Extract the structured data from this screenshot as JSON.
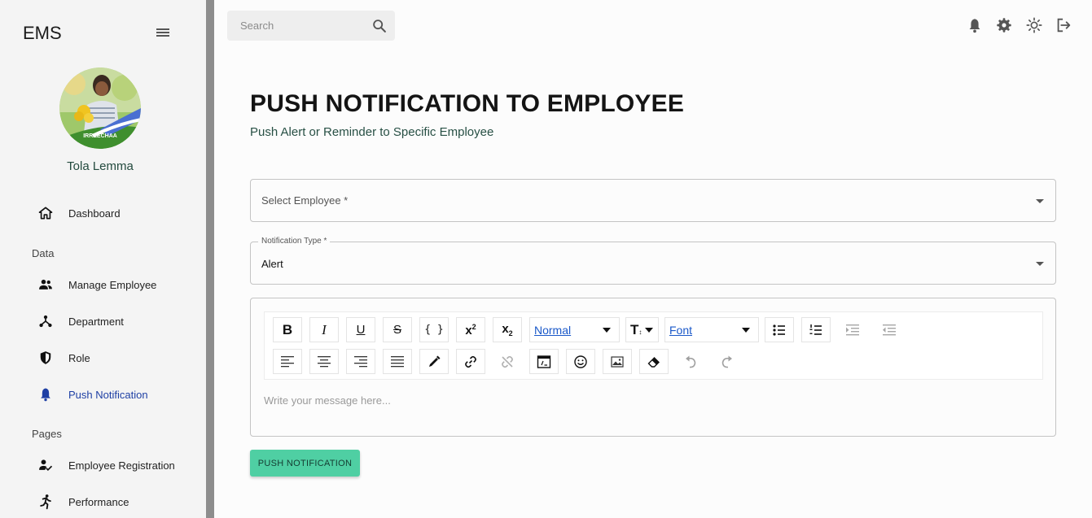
{
  "app": {
    "brand": "EMS"
  },
  "user": {
    "name": "Tola Lemma",
    "avatar_caption": "IRREECHAA"
  },
  "sidebar": {
    "items": [
      {
        "label": "Dashboard",
        "icon": "home-icon"
      },
      {
        "label": "Manage Employee",
        "icon": "people-icon"
      },
      {
        "label": "Department",
        "icon": "hierarchy-icon"
      },
      {
        "label": "Role",
        "icon": "shield-icon"
      },
      {
        "label": "Push Notification",
        "icon": "bell-icon",
        "active": true
      },
      {
        "label": "Employee Registration",
        "icon": "person-check-icon"
      },
      {
        "label": "Performance",
        "icon": "running-icon"
      }
    ],
    "sections": {
      "data": "Data",
      "pages": "Pages"
    }
  },
  "search": {
    "placeholder": "Search"
  },
  "header": {
    "icons": [
      "bell-icon",
      "gear-icon",
      "sun-icon",
      "logout-icon"
    ]
  },
  "main": {
    "title": "PUSH NOTIFICATION TO EMPLOYEE",
    "subtitle": "Push Alert or Reminder to Specific Employee",
    "employee_select": {
      "label": "Select Employee *",
      "value": ""
    },
    "type_select": {
      "label": "Notification Type *",
      "value": "Alert"
    },
    "editor": {
      "header_dropdown": "Normal",
      "font_dropdown": "Font",
      "placeholder": "Write your message here..."
    },
    "submit_label": "PUSH NOTIFICATION"
  },
  "colors": {
    "accent": "#4fcfa3",
    "active_nav": "#1e3fa4",
    "sidebar_bg": "#f4f4f4",
    "sidebar_edge": "#8d8d8d"
  }
}
